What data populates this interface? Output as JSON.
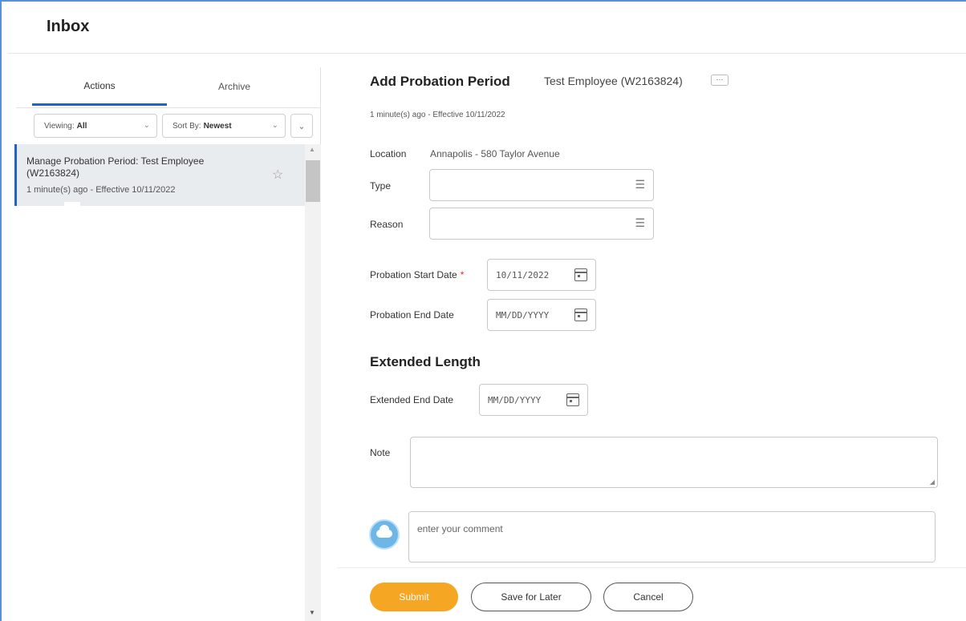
{
  "header": {
    "title": "Inbox"
  },
  "tabs": {
    "actions": "Actions",
    "archive": "Archive"
  },
  "filters": {
    "viewing_label": "Viewing:",
    "viewing_value": "All",
    "sort_label": "Sort By:",
    "sort_value": "Newest"
  },
  "inbox_items": [
    {
      "title": "Manage Probation Period: Test Employee (W2163824)",
      "subtitle": "1 minute(s) ago - Effective 10/11/2022"
    }
  ],
  "form": {
    "title": "Add Probation Period",
    "employee": "Test Employee (W2163824)",
    "more_label": "···",
    "meta": "1 minute(s) ago - Effective 10/11/2022",
    "location_label": "Location",
    "location_value": "Annapolis - 580 Taylor Avenue",
    "type_label": "Type",
    "reason_label": "Reason",
    "start_date_label": "Probation Start Date",
    "required_mark": "*",
    "start_date_value": "10/11/2022",
    "end_date_label": "Probation End Date",
    "date_placeholder": "MM/DD/YYYY",
    "extended_title": "Extended Length",
    "extended_end_label": "Extended End Date",
    "note_label": "Note",
    "comment_placeholder": "enter your comment"
  },
  "buttons": {
    "submit": "Submit",
    "save_for_later": "Save for Later",
    "cancel": "Cancel"
  },
  "colors": {
    "accent": "#1f63c6",
    "submit": "#f5a623",
    "required": "#d92a2a"
  },
  "icons": [
    "star-icon",
    "list-icon",
    "calendar-icon",
    "chevron-down-icon",
    "cloud-avatar-icon"
  ]
}
